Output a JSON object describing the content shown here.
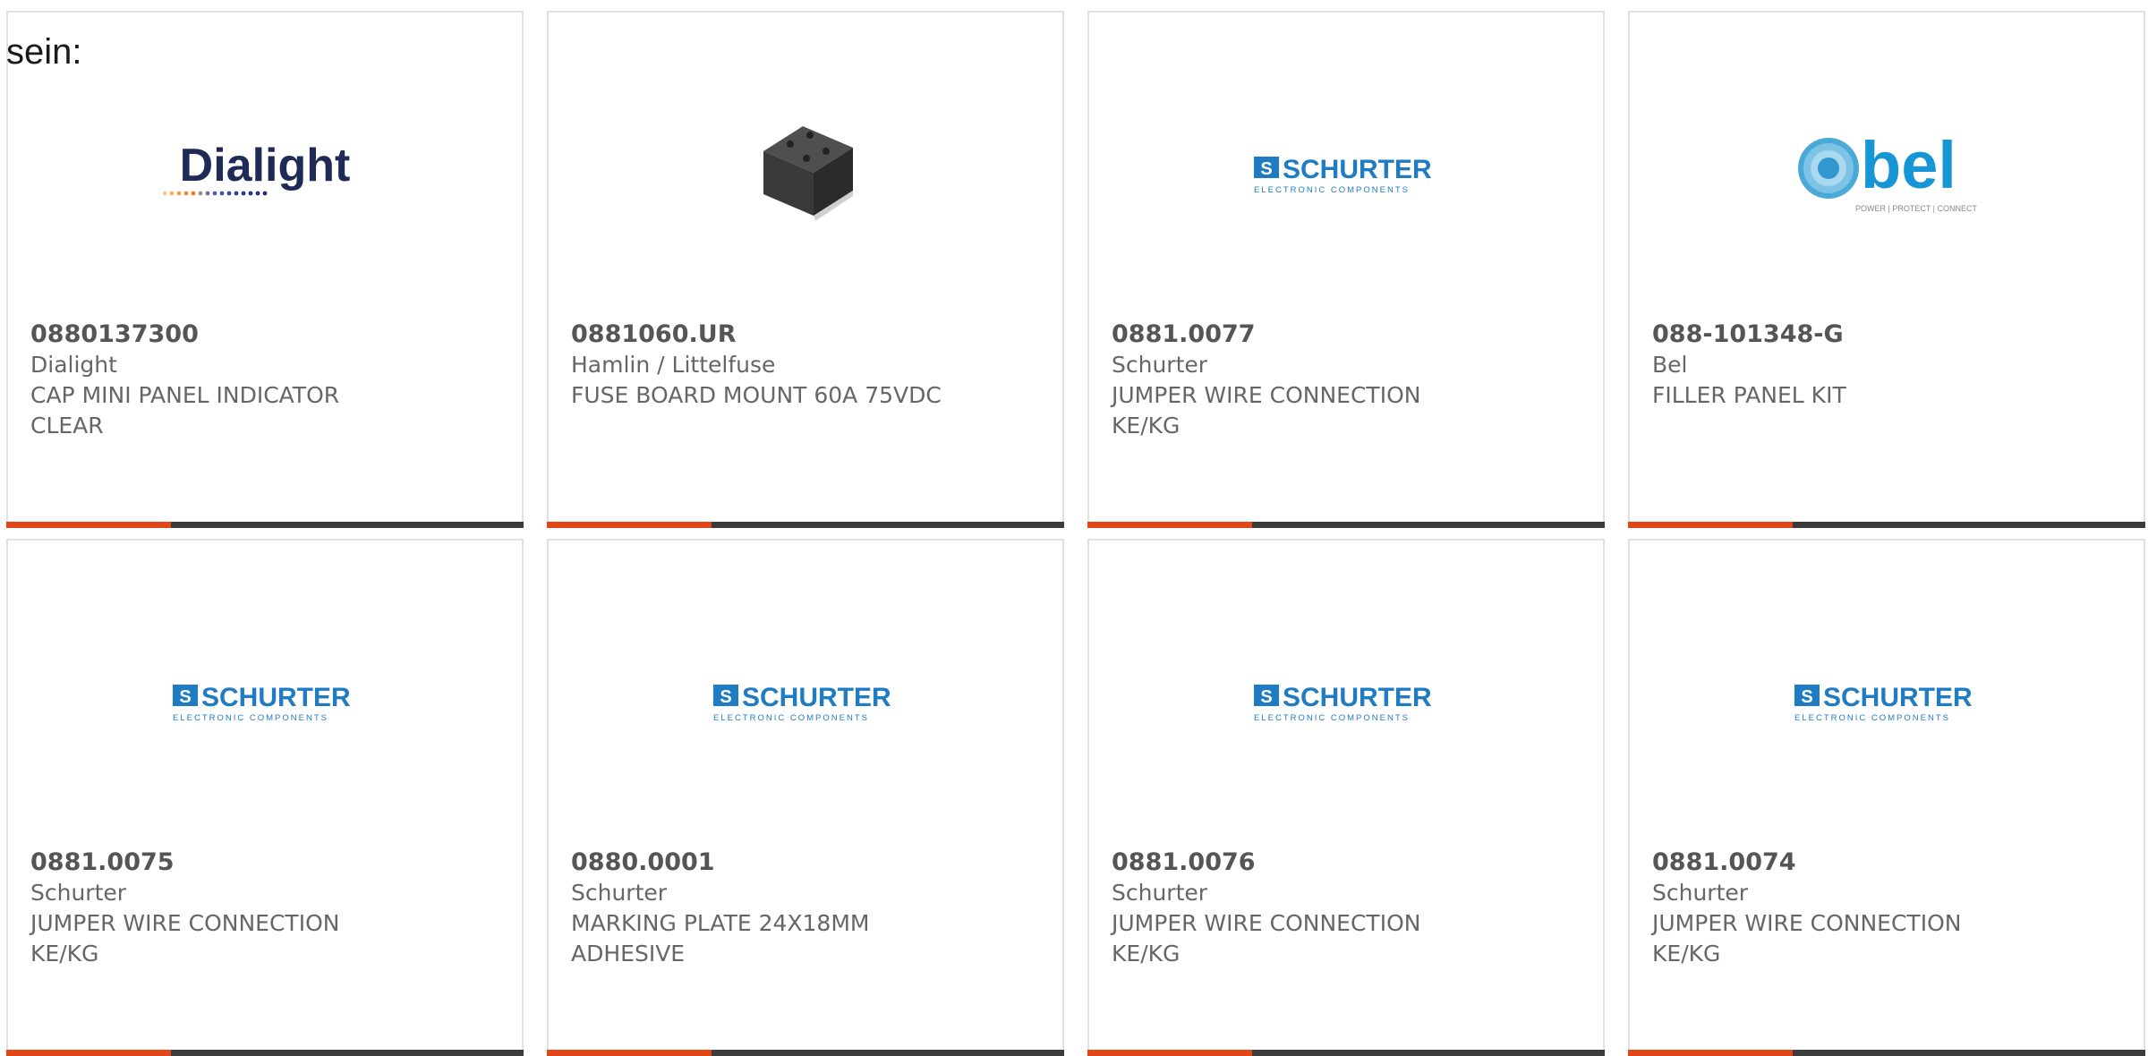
{
  "lead_text": "sein:",
  "colors": {
    "accent": "#e24616",
    "bar": "#3c3c3c",
    "border": "#e1e1e1",
    "text": "#666666"
  },
  "products": [
    {
      "part": "0880137300",
      "manufacturer": "Dialight",
      "description": "CAP MINI PANEL INDICATOR\nCLEAR",
      "logo": "Dialight"
    },
    {
      "part": "0881060.UR",
      "manufacturer": "Hamlin / Littelfuse",
      "description": "FUSE BOARD MOUNT 60A 75VDC",
      "logo": ""
    },
    {
      "part": "0881.0077",
      "manufacturer": "Schurter",
      "description": "JUMPER WIRE CONNECTION\nKE/KG",
      "logo": "SCHURTER"
    },
    {
      "part": "088-101348-G",
      "manufacturer": "Bel",
      "description": "FILLER PANEL KIT",
      "logo": "bel"
    },
    {
      "part": "0881.0075",
      "manufacturer": "Schurter",
      "description": "JUMPER WIRE CONNECTION\nKE/KG",
      "logo": "SCHURTER"
    },
    {
      "part": "0880.0001",
      "manufacturer": "Schurter",
      "description": "MARKING PLATE 24X18MM\nADHESIVE",
      "logo": "SCHURTER"
    },
    {
      "part": "0881.0076",
      "manufacturer": "Schurter",
      "description": "JUMPER WIRE CONNECTION\nKE/KG",
      "logo": "SCHURTER"
    },
    {
      "part": "0881.0074",
      "manufacturer": "Schurter",
      "description": "JUMPER WIRE CONNECTION\nKE/KG",
      "logo": "SCHURTER"
    }
  ],
  "logo_subtext": {
    "schurter": "ELECTRONIC COMPONENTS",
    "bel": "POWER | PROTECT | CONNECT"
  }
}
